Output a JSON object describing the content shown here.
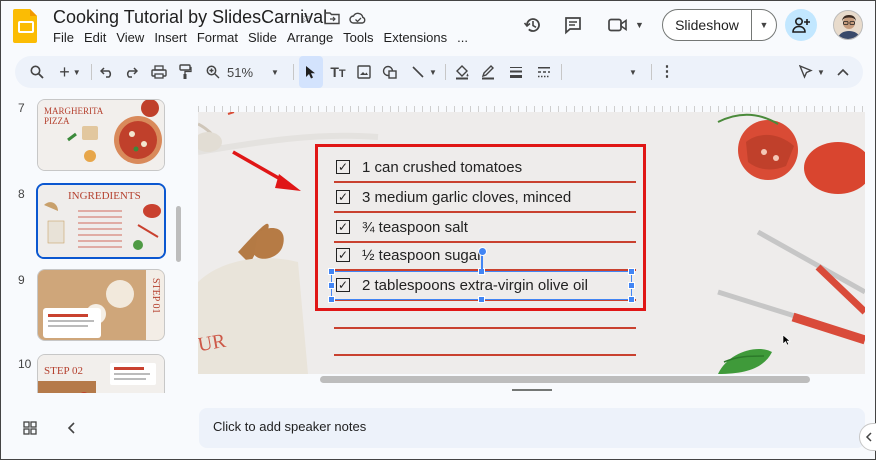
{
  "app": {
    "doc_title": "Cooking Tutorial by SlidesCarnival",
    "menu": [
      "File",
      "Edit",
      "View",
      "Insert",
      "Format",
      "Slide",
      "Arrange",
      "Tools",
      "Extensions",
      "..."
    ],
    "slideshow_label": "Slideshow"
  },
  "toolbar": {
    "zoom": "51%"
  },
  "filmstrip": {
    "slides": [
      {
        "number": "7",
        "title": "MARGHERITA PIZZA"
      },
      {
        "number": "8",
        "title": "INGREDIENTS"
      },
      {
        "number": "9",
        "title": "STEP 01"
      },
      {
        "number": "10",
        "title": "STEP 02"
      }
    ]
  },
  "slide": {
    "items": [
      {
        "check": "☑",
        "text": "1 can crushed tomatoes"
      },
      {
        "check": "☑",
        "text": "3 medium garlic cloves, minced"
      },
      {
        "check": "☑",
        "text": "¾ teaspoon salt"
      },
      {
        "check": "☑",
        "text": "½ teaspoon sugar"
      },
      {
        "check": "☑",
        "text": "2 tablespoons extra-virgin olive oil"
      }
    ],
    "decor_text": "UR"
  },
  "notes": {
    "placeholder": "Click to add speaker notes"
  },
  "colors": {
    "accent_blue": "#0b57d0",
    "highlight_red": "#e01616",
    "line_red": "#c9412f",
    "share_bg": "#c2e7ff"
  }
}
